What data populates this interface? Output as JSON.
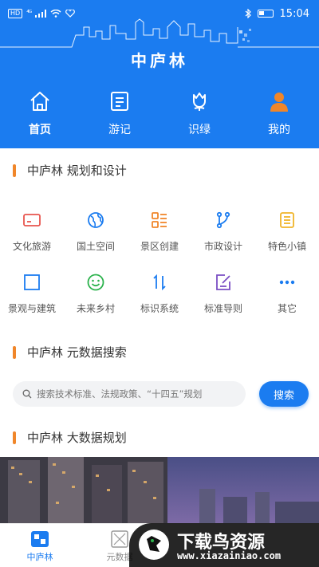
{
  "status_bar": {
    "time": "15:04",
    "network_badge": "HD",
    "signal": "⁴ᴳ"
  },
  "header": {
    "title": "中庐林"
  },
  "top_nav": [
    {
      "label": "首页",
      "icon": "home-icon",
      "active": true
    },
    {
      "label": "游记",
      "icon": "notes-icon",
      "active": false
    },
    {
      "label": "识绿",
      "icon": "tulip-icon",
      "active": false
    },
    {
      "label": "我的",
      "icon": "user-icon",
      "active": false
    }
  ],
  "planning": {
    "title": "中庐林 规划和设计",
    "items": [
      {
        "label": "文化旅游",
        "icon": "card-icon",
        "color": "#e8554e"
      },
      {
        "label": "国土空间",
        "icon": "globe-icon",
        "color": "#1b7cf0"
      },
      {
        "label": "景区创建",
        "icon": "list-grid-icon",
        "color": "#f0862a"
      },
      {
        "label": "市政设计",
        "icon": "branch-icon",
        "color": "#1b7cf0"
      },
      {
        "label": "特色小镇",
        "icon": "document-icon",
        "color": "#f0b429"
      },
      {
        "label": "景观与建筑",
        "icon": "square-icon",
        "color": "#1b7cf0"
      },
      {
        "label": "未来乡村",
        "icon": "smile-icon",
        "color": "#2bb24c"
      },
      {
        "label": "标识系统",
        "icon": "arrows-icon",
        "color": "#1b7cf0"
      },
      {
        "label": "标准导则",
        "icon": "edit-icon",
        "color": "#7b4fc4"
      },
      {
        "label": "其它",
        "icon": "more-icon",
        "color": "#1b7cf0"
      }
    ]
  },
  "search": {
    "title": "中庐林 元数据搜索",
    "placeholder": "搜索技术标准、法规政策、“十四五”规划",
    "button_label": "搜索"
  },
  "bigdata": {
    "title": "中庐林 大数据规划"
  },
  "bottom_nav": [
    {
      "label": "中庐林",
      "active": true
    },
    {
      "label": "元数据",
      "active": false
    }
  ],
  "watermark": {
    "text": "下载鸟资源",
    "url": "www.xiazainiao.com"
  }
}
